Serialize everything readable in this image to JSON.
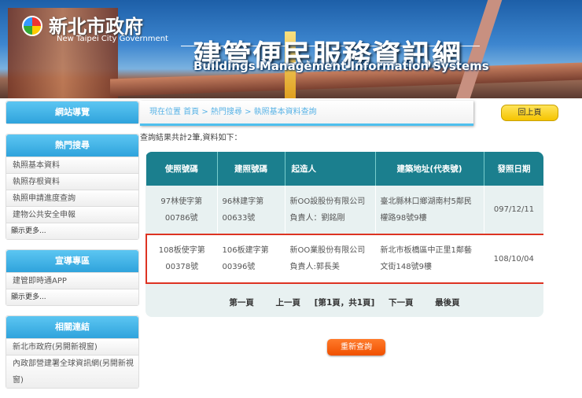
{
  "header": {
    "gov_name": "新北市政府",
    "gov_en": "New Taipei City Government",
    "title": "建管便民服務資訊網",
    "title_en": "Buildings Management Information Systems"
  },
  "sidebar": {
    "nav": "網站導覽",
    "popular": {
      "title": "熱門搜尋",
      "items": [
        "執照基本資料",
        "執照存根資料",
        "執照申請進度查詢",
        "建物公共安全申報"
      ],
      "more": "顯示更多..."
    },
    "promo": {
      "title": "宣導專區",
      "items": [
        "建管即時通APP"
      ],
      "more": "顯示更多..."
    },
    "links": {
      "title": "相關連結",
      "items": [
        "新北市政府(另開新視窗)",
        "內政部營建署全球資訊網(另開新視窗)"
      ]
    }
  },
  "breadcrumb": "現在位置 首頁 > 熱門搜尋 > 執照基本資料查詢",
  "back_label": "回上頁",
  "summary": "查詢結果共計2筆,資料如下：",
  "table": {
    "headers": [
      "使照號碼",
      "建照號碼",
      "起造人",
      "建築地址(代表號)",
      "發照日期"
    ],
    "rows": [
      [
        "97林使字第00786號",
        "96林建字第00633號",
        "新OO設股份有限公司負責人：劉銘剛",
        "臺北縣林口鄉湖南村5鄰民權路98號9樓",
        "097/12/11"
      ],
      [
        "108板使字第00378號",
        "106板建字第00396號",
        "新OO業股份有限公司負責人:郭長美",
        "新北市板橋區中正里1鄰藝文街148號9樓",
        "108/10/04"
      ]
    ]
  },
  "pager": {
    "first": "第一頁",
    "prev": "上一頁",
    "current": "[第1頁，共1頁]",
    "next": "下一頁",
    "last": "最後頁"
  },
  "reset_label": "重新查詢",
  "colors": {
    "header_teal": "#1b7f8e",
    "sidebar_blue": "#2fa3dc",
    "highlight_red": "#d32222",
    "back_yellow": "#f5c400",
    "reset_orange": "#f05000"
  }
}
